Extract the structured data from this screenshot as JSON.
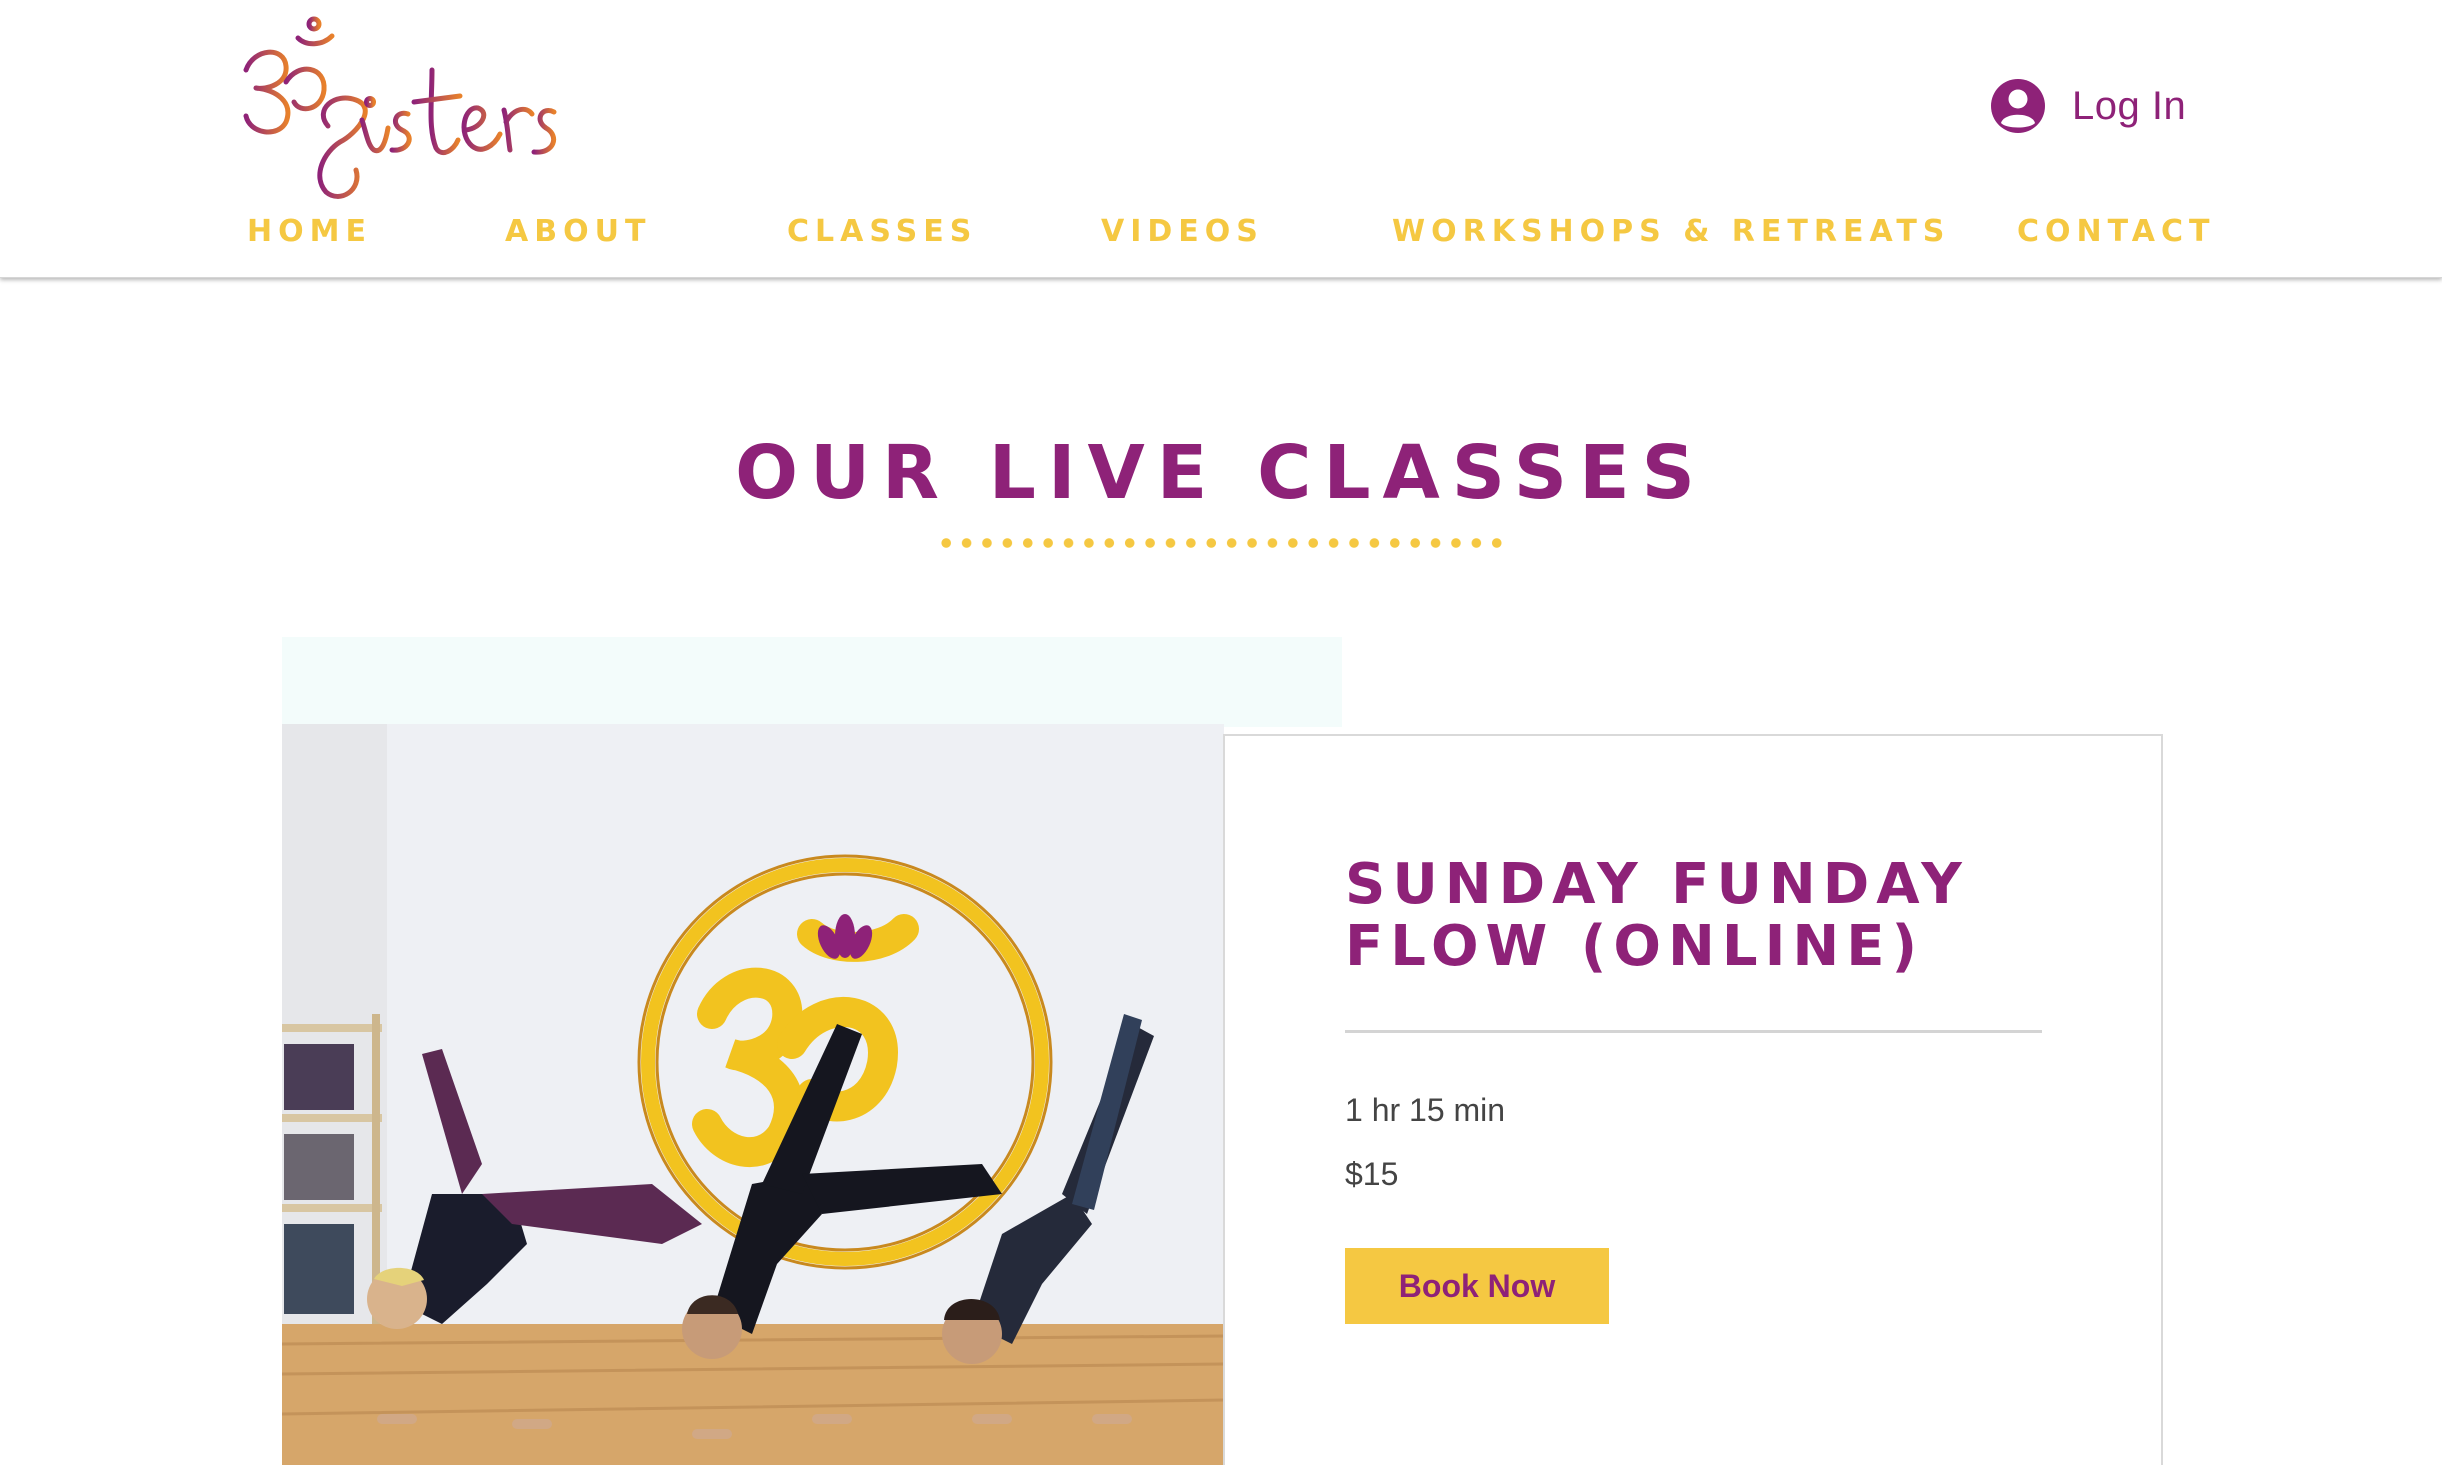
{
  "brand": {
    "logo_text": "ॐsisters",
    "primary_color": "#8e2278",
    "accent_color": "#f5c842",
    "logo_gradient": [
      "#8e2278",
      "#e8812b"
    ]
  },
  "header": {
    "login_label": "Log In",
    "login_icon": "user-avatar-icon"
  },
  "nav": {
    "items": [
      {
        "label": "Home"
      },
      {
        "label": "About"
      },
      {
        "label": "Classes"
      },
      {
        "label": "Videos"
      },
      {
        "label": "Workshops & Retreats"
      },
      {
        "label": "Contact"
      }
    ]
  },
  "main": {
    "section_title": "Our Live Classes",
    "class_card": {
      "title": "Sunday Funday Flow (Online)",
      "duration": "1 hr 15 min",
      "price": "$15",
      "book_label": "Book Now"
    }
  }
}
